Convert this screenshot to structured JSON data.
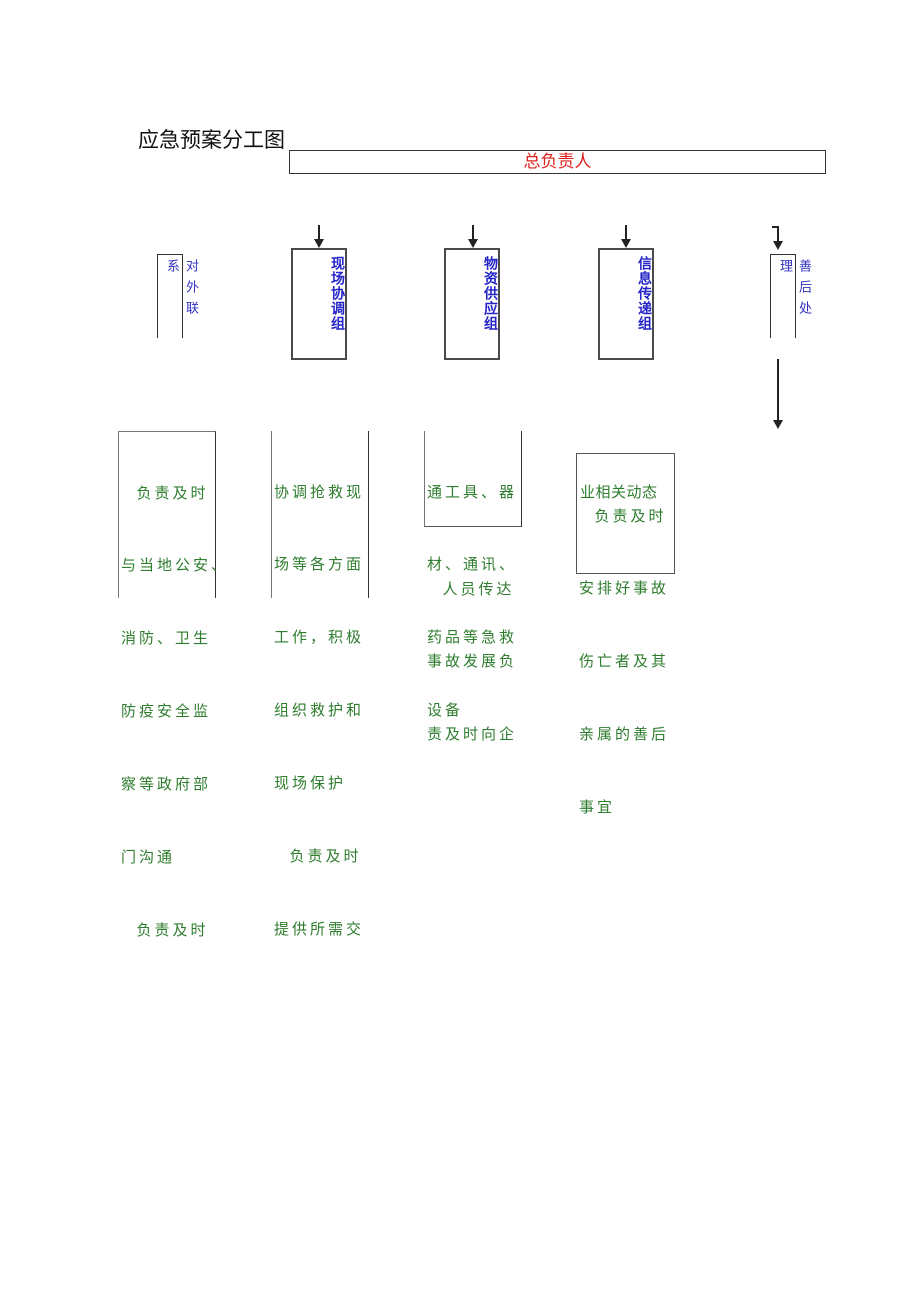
{
  "title": "应急预案分工图",
  "chief": "总负责人",
  "side_left": {
    "label": "对外联系"
  },
  "side_right": {
    "label": "善后处理"
  },
  "groups": [
    {
      "label": "现场协调组"
    },
    {
      "label": "物资供应组"
    },
    {
      "label": "信息传递组"
    }
  ],
  "duties": {
    "external": {
      "lines": [
        "  负责及时",
        "与当地公安、",
        "消防、卫生",
        "防疫安全监",
        "察等政府部",
        "门沟通",
        "  负责及时"
      ]
    },
    "onsite": {
      "lines": [
        "协调抢救现",
        "场等各方面",
        "工作，积极",
        "组织救护和",
        "现场保护",
        "  负责及时",
        "提供所需交"
      ]
    },
    "supply": {
      "boxed_lines": [
        "通工具、器",
        "材、通讯、",
        "药品等急救",
        "设备"
      ],
      "lines": [
        "  人员传达",
        "事故发展负",
        "责及时向企"
      ]
    },
    "info": {
      "top_line": "业相关动态",
      "boxed_lines": [
        "  负责及时",
        "安排好事故",
        "伤亡者及其",
        "亲属的善后",
        "事宜"
      ]
    }
  },
  "colors": {
    "chief_text": "#e0211e",
    "group_text": "#2525c8",
    "side_text": "#3030c0",
    "duty_text": "#2f7d2f",
    "border": "#333333"
  }
}
